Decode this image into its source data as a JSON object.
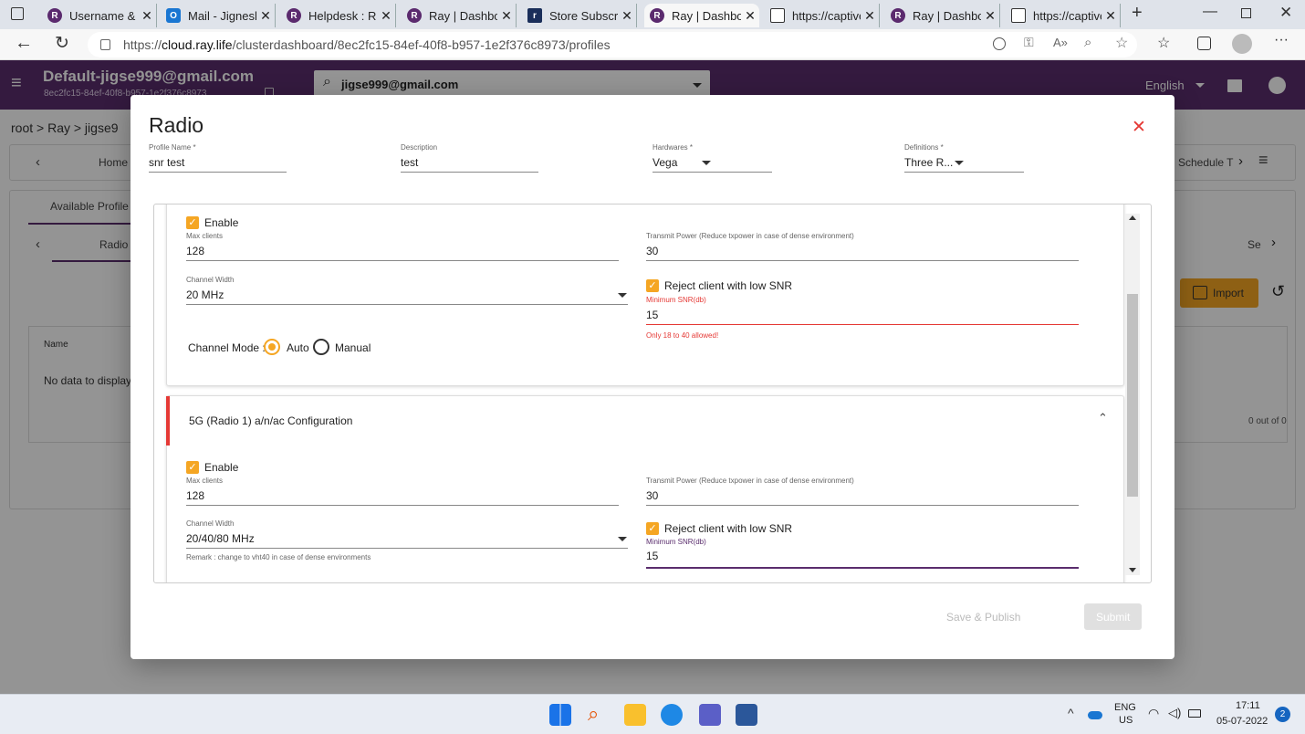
{
  "browser": {
    "tabs": [
      {
        "label": "Username & P",
        "icon": "ray-icon"
      },
      {
        "label": "Mail - Jignesh",
        "icon": "mail-icon"
      },
      {
        "label": "Helpdesk : Ray",
        "icon": "ray-icon"
      },
      {
        "label": "Ray | Dashboa",
        "icon": "ray-icon"
      },
      {
        "label": "Store Subscrip",
        "icon": "store-icon"
      },
      {
        "label": "Ray | Dashboa",
        "icon": "ray-icon"
      },
      {
        "label": "https://captive",
        "icon": "page-icon"
      },
      {
        "label": "Ray | Dashboa",
        "icon": "ray-icon"
      },
      {
        "label": "https://captive",
        "icon": "page-icon"
      }
    ],
    "url_prefix": "https://",
    "url_domain": "cloud.ray.life",
    "url_path": "/clusterdashboard/8ec2fc15-84ef-40f8-b957-1e2f376c8973/profiles"
  },
  "app": {
    "account_email": "Default-jigse999@gmail.com",
    "account_id": "8ec2fc15-84ef-40f8-b957-1e2f376c8973",
    "search_value": "jigse999@gmail.com",
    "language": "English",
    "breadcrumb": "root > Ray > jigse9",
    "nav_home": "Home",
    "nav_schedule": "Schedule T",
    "available_profiles": "Available Profile",
    "radio_tab": "Radio",
    "sec_tab": "Se",
    "import_label": "Import",
    "name_header": "Name",
    "no_data": "No data to display",
    "pager": "0 out of 0"
  },
  "modal": {
    "title": "Radio",
    "profile_name_label": "Profile Name *",
    "profile_name_value": "snr test",
    "description_label": "Description",
    "description_value": "test",
    "hardwares_label": "Hardwares *",
    "hardwares_value": "Vega",
    "definitions_label": "Definitions *",
    "definitions_value": "Three R...",
    "section1": {
      "enable_label": "Enable",
      "max_clients_label": "Max clients",
      "max_clients_value": "128",
      "tx_power_label": "Transmit Power (Reduce txpower in case of dense environment)",
      "tx_power_value": "30",
      "channel_width_label": "Channel Width",
      "channel_width_value": "20 MHz",
      "reject_label": "Reject client with low SNR",
      "min_snr_label": "Minimum SNR(db)",
      "min_snr_value": "15",
      "snr_error": "Only 18 to 40 allowed!",
      "channel_mode_label": "Channel Mode :",
      "mode_auto": "Auto",
      "mode_manual": "Manual"
    },
    "section2": {
      "title": "5G (Radio 1) a/n/ac Configuration",
      "enable_label": "Enable",
      "max_clients_label": "Max clients",
      "max_clients_value": "128",
      "tx_power_label": "Transmit Power (Reduce txpower in case of dense environment)",
      "tx_power_value": "30",
      "channel_width_label": "Channel Width",
      "channel_width_value": "20/40/80 MHz",
      "remark": "Remark : change to vht40 in case of dense environments",
      "reject_label": "Reject client with low SNR",
      "min_snr_label": "Minimum SNR(db)",
      "min_snr_value": "15"
    },
    "save_publish_label": "Save & Publish",
    "submit_label": "Submit"
  },
  "taskbar": {
    "lang_top": "ENG",
    "lang_bottom": "US",
    "time": "17:11",
    "date": "05-07-2022",
    "notification_count": "2"
  },
  "colors": {
    "header": "#5a2d6d",
    "accent": "#f5a623",
    "error": "#e53935",
    "focus": "#5a2d6d"
  }
}
